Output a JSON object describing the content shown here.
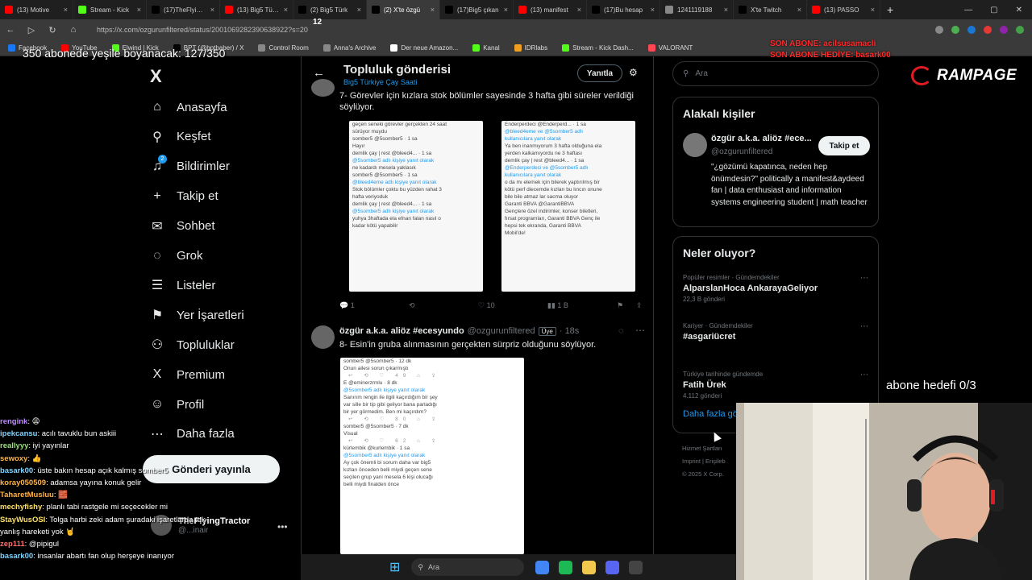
{
  "browser": {
    "tabs": [
      {
        "label": "(13) Motive",
        "color": "#ff0000",
        "active": false
      },
      {
        "label": "Stream - Kick",
        "color": "#53fc18",
        "active": false
      },
      {
        "label": "(17)TheFlyingTr",
        "color": "#000000",
        "active": false
      },
      {
        "label": "(13) Big5 Türkiye",
        "color": "#ff0000",
        "active": false
      },
      {
        "label": "(2) Big5 Türk",
        "color": "#000000",
        "active": false
      },
      {
        "label": "(2) X'te özgü",
        "color": "#000000",
        "active": true
      },
      {
        "label": "(17)Big5 çıkan",
        "color": "#000000",
        "active": false
      },
      {
        "label": "(13) manifest",
        "color": "#ff0000",
        "active": false
      },
      {
        "label": "(17)Bu hesap",
        "color": "#000000",
        "active": false
      },
      {
        "label": "1241119188",
        "color": "#888888",
        "active": false
      },
      {
        "label": "X'te Twitch",
        "color": "#000000",
        "active": false
      },
      {
        "label": "(13) PASSO",
        "color": "#ff0000",
        "active": false
      }
    ],
    "new_tab": "+",
    "url": "https://x.com/ozgurunfiltered/status/2001069282390638922?s=20",
    "bookmarks": [
      {
        "label": "Facebook",
        "color": "#1877f2"
      },
      {
        "label": "YouTube",
        "color": "#ff0000"
      },
      {
        "label": "Elwind | Kick",
        "color": "#53fc18"
      },
      {
        "label": "BPT (@bpthaber) / X",
        "color": "#000000"
      },
      {
        "label": "Control Room",
        "color": "#888888"
      },
      {
        "label": "Anna's Archive",
        "color": "#888888"
      },
      {
        "label": "Der neue Amazon...",
        "color": "#ffffff"
      },
      {
        "label": "Kanal",
        "color": "#53fc18"
      },
      {
        "label": "IDRlabs",
        "color": "#f0a020"
      },
      {
        "label": "Stream - Kick Dash...",
        "color": "#53fc18"
      },
      {
        "label": "VALORANT",
        "color": "#ff4655"
      }
    ]
  },
  "overlay": {
    "sub_goal": "350 abonede yeşile boyanacak: 127/350",
    "son_abone_1": "SON ABONE: acilsusamacli",
    "son_abone_2": "SON ABONE HEDİYE: basark00",
    "brand": "RAMPAGE",
    "abone_hedefi": "abone hedefi 0/3",
    "tab_count_badge": "12"
  },
  "sidebar": {
    "logo": "X",
    "items": [
      {
        "label": "Anasayfa",
        "icon": "⌂"
      },
      {
        "label": "Keşfet",
        "icon": "⚲"
      },
      {
        "label": "Bildirimler",
        "icon": "♫",
        "badge": "2"
      },
      {
        "label": "Takip et",
        "icon": "+"
      },
      {
        "label": "Sohbet",
        "icon": "✉"
      },
      {
        "label": "Grok",
        "icon": "◌"
      },
      {
        "label": "Listeler",
        "icon": "☰"
      },
      {
        "label": "Yer İşaretleri",
        "icon": "⚑"
      },
      {
        "label": "Topluluklar",
        "icon": "⚇"
      },
      {
        "label": "Premium",
        "icon": "X"
      },
      {
        "label": "Profil",
        "icon": "☺"
      },
      {
        "label": "Daha fazla",
        "icon": "⋯"
      }
    ],
    "post_button": "Gönderi yayınla",
    "account_name": "TheFlyingTractor",
    "account_handle": "@...inair",
    "account_more": "•••"
  },
  "chat": [
    {
      "user": "rengink",
      "color": "#c08bff",
      "msg": ": 😩"
    },
    {
      "user": "ipekcansu",
      "color": "#7fd3ff",
      "msg": ": acılı tavuklu bun askiii"
    },
    {
      "user": "reallyyy",
      "color": "#9be37a",
      "msg": ": iyi yayınlar"
    },
    {
      "user": "sewoxy",
      "color": "#ffb347",
      "msg": ": 👍"
    },
    {
      "user": "basark00",
      "color": "#7fd3ff",
      "msg": ": üste bakın hesap açık kalmış somber5"
    },
    {
      "user": "koray050509",
      "color": "#ffb347",
      "msg": ": adamsa yayına konuk gelir"
    },
    {
      "user": "TaharetMusluu",
      "color": "#ffb347",
      "msg": ": 🧱"
    },
    {
      "user": "mechyfishy",
      "color": "#ffe066",
      "msg": ": planlı tabi rastgele mi seçecekler mi"
    },
    {
      "user": "StayWusOSI",
      "color": "#ffe066",
      "msg": ": Tolga harbi zeki adam şuradaki işaretlarda tek"
    },
    {
      "user": "",
      "color": "#ffffff",
      "msg": "yanlış hareketi yok 🤘"
    },
    {
      "user": "zep111",
      "color": "#ff6b6b",
      "msg": ": @pipigul"
    },
    {
      "user": "basark00",
      "color": "#7fd3ff",
      "msg": ": insanlar abartı fan olup herşeye inanıyor"
    }
  ],
  "main": {
    "title": "Topluluk gönderisi",
    "subtitle": "Big5 Türkiye Çay Saati",
    "reply_label": "Yanıtla",
    "tweet1": {
      "text": "7- Görevler için kızlara stok bölümler sayesinde 3 hafta gibi süreler verildiği söylüyor.",
      "media_left": [
        {
          "t": "geçen seneki görevler gerçekten 24 saat",
          "c": ""
        },
        {
          "t": "sürüyor muydu",
          "c": ""
        },
        {
          "t": "somber5 @5somber5 · 1 sa",
          "c": "mn"
        },
        {
          "t": "Hayır",
          "c": ""
        },
        {
          "t": "demlik çay | rest @bleed4... · 1 sa",
          "c": "mn"
        },
        {
          "t": "@5somber5 adlı kişiye yanıt olarak",
          "c": "lk"
        },
        {
          "t": "ne kadardı mesela yaklasık",
          "c": ""
        },
        {
          "t": "somber5 @5somber5 · 1 sa",
          "c": "mn"
        },
        {
          "t": "@bleed4eme adlı kişiye yanıt olarak",
          "c": "lk"
        },
        {
          "t": "Stok bölümler çoktu bu yüzden rahat 3",
          "c": ""
        },
        {
          "t": "hafta veriyoduk",
          "c": ""
        },
        {
          "t": "demlik çay | rest @bleed4... · 1 sa",
          "c": "mn"
        },
        {
          "t": "@5somber5 adlı kişiye yanıt olarak",
          "c": "lk"
        },
        {
          "t": "yuhya 3haftada ela efnan falan nasıl o",
          "c": ""
        },
        {
          "t": "kadar kötü yapabilir",
          "c": ""
        }
      ],
      "media_right": [
        {
          "t": "Enderperdeci @Enderperd... · 1 sa",
          "c": "mn"
        },
        {
          "t": "@bleed4eme ve @5somber5 adlı",
          "c": "lk"
        },
        {
          "t": "kullanıcılara yanıt olarak",
          "c": "lk"
        },
        {
          "t": "Ya ben inanmıyorum 3 hafta olduğuna ela",
          "c": ""
        },
        {
          "t": "yerden kalkamıyordu ne 3 haftası",
          "c": ""
        },
        {
          "t": "demlik çay | rest @bleed4... · 1 sa",
          "c": "mn"
        },
        {
          "t": "@Enderperdeci ve @5somber5 adlı",
          "c": "lk"
        },
        {
          "t": "kullanıcılara yanıt olarak",
          "c": "lk"
        },
        {
          "t": "o da mı elemek için bilerek yaptırılmış bir",
          "c": ""
        },
        {
          "t": "kötü perf diecemde kızları bu lıncın onune",
          "c": ""
        },
        {
          "t": "bile bile atmaz lar sacma oluyor",
          "c": ""
        },
        {
          "t": "Garanti BBVA @GarantiBBVA",
          "c": "mn"
        },
        {
          "t": "Gençlere özel indirimler, konser biletleri,",
          "c": ""
        },
        {
          "t": "fırsat programları, Garanti BBVA Genç ile",
          "c": ""
        },
        {
          "t": "hepsi tek ekranda, Garanti BBVA",
          "c": ""
        },
        {
          "t": "Mobil'de!",
          "c": ""
        }
      ],
      "replies": "1",
      "likes": "10",
      "views": "1 B"
    },
    "tweet2": {
      "name": "özgür a.k.a. aliöz #ecesyundo",
      "handle": "@ozgurunfiltered",
      "badge": "Üye",
      "time": "· 18s",
      "text": "8- Esin'in gruba alınmasının gerçekten sürpriz olduğunu söylüyor.",
      "media": [
        {
          "t": "somber5 @5somber5 · 12 dk",
          "c": "mn"
        },
        {
          "t": "Onun ailesi sorun çıkarmıştı",
          "c": ""
        },
        {
          "t": "↩   ⟲   ♡ 49   ⌂   ⇪",
          "c": "act"
        },
        {
          "t": "E @eminerzrmlu · 8 dk",
          "c": "mn"
        },
        {
          "t": "@5somber5 adlı kişiye yanıt olarak",
          "c": "lk"
        },
        {
          "t": "Sanırım rengin ile ilgili kaçırdığım bir şey",
          "c": ""
        },
        {
          "t": "var sille bir tip gibi geliyor bana parladığı",
          "c": ""
        },
        {
          "t": "bir yer görmedim. Ben mi kaçırdım?",
          "c": ""
        },
        {
          "t": "↩   ⟲   ♡ 80   ⌂   ⇪",
          "c": "act"
        },
        {
          "t": "somber5 @5somber5 · 7 dk",
          "c": "mn"
        },
        {
          "t": "Visual",
          "c": ""
        },
        {
          "t": "↩   ⟲   ♡ 62   ⌂   ⇪",
          "c": "act"
        },
        {
          "t": "kürlembik @kurlembik · 1 sa",
          "c": "mn"
        },
        {
          "t": "@5somber5 adlı kişiye yanıt olarak",
          "c": "lk"
        },
        {
          "t": "Ay çok önemli bi sorum daha var big5",
          "c": ""
        },
        {
          "t": "kızları önceden belli miydi geçen sene",
          "c": ""
        },
        {
          "t": "seçilen grup yani mesela 6 kişi olucağı",
          "c": ""
        },
        {
          "t": "belli miydi finalden önce",
          "c": ""
        }
      ]
    }
  },
  "right": {
    "search_placeholder": "Ara",
    "related_title": "Alakalı kişiler",
    "person": {
      "name": "özgür a.k.a. aliöz #ece...",
      "handle": "@ozgurunfiltered",
      "follow": "Takip et",
      "bio": "\"¿gözümü kapatınca, neden hep önümdesin?\" politically a manifest&aydeed fan | data enthusiast and information systems engineering student | math teacher"
    },
    "trends_title": "Neler oluyor?",
    "trends": [
      {
        "cat": "Popüler resimler · Gündemdekiler",
        "name": "AlparslanHoca AnkarayaGeliyor",
        "count": "22,3 B gönderi"
      },
      {
        "cat": "Kariyer · Gündemdekiler",
        "name": "#asgariücret",
        "count": ""
      },
      {
        "cat": "Türkiye tarihinde gündemde",
        "name": "Fatih Ürek",
        "count": "4.112 gönderi"
      }
    ],
    "show_more": "Daha fazla gö",
    "footer": [
      "Hizmet Şartları",
      "Imprint  |  Erişileb",
      "© 2025 X Corp."
    ]
  },
  "taskbar": {
    "search": "Ara",
    "icons": [
      {
        "name": "chrome",
        "color": "#4285f4"
      },
      {
        "name": "spotify",
        "color": "#1db954"
      },
      {
        "name": "files",
        "color": "#f2c94c"
      },
      {
        "name": "discord",
        "color": "#5865f2"
      },
      {
        "name": "obs",
        "color": "#444444"
      }
    ]
  }
}
